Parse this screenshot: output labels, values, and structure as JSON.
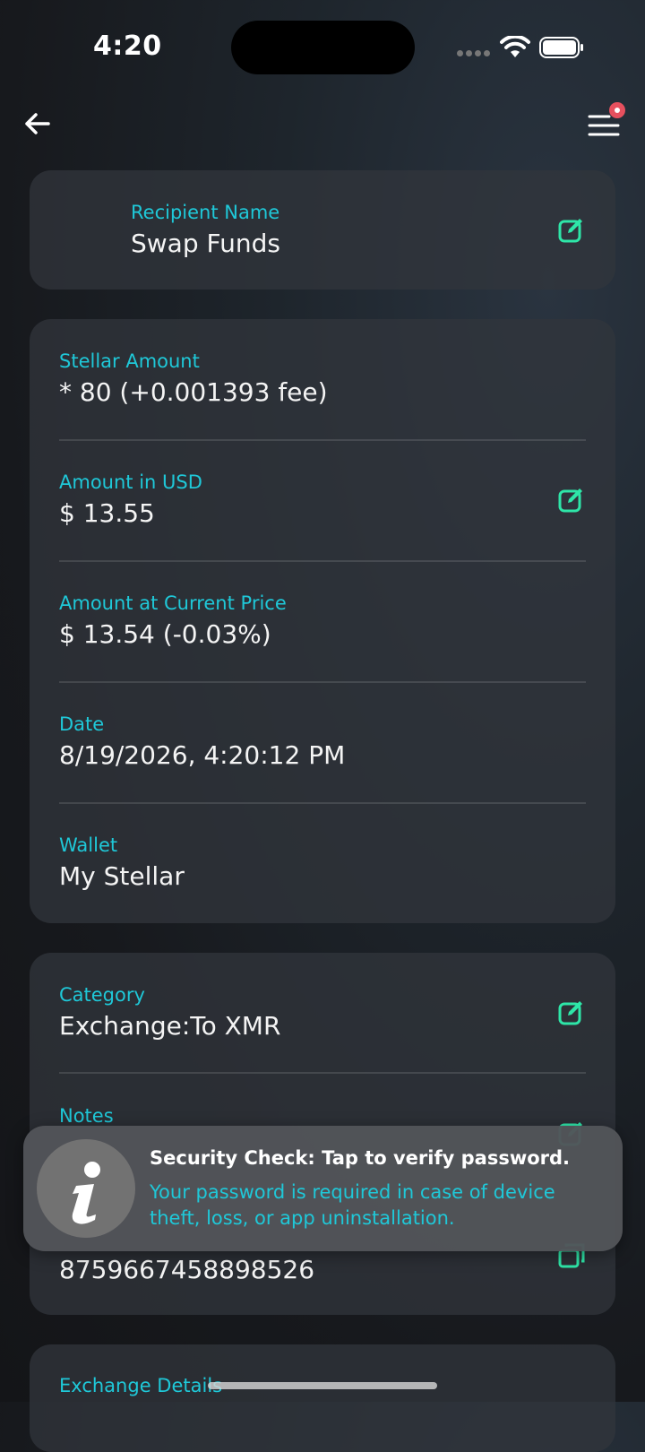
{
  "status_bar": {
    "time": "4:20"
  },
  "recipient": {
    "label": "Recipient Name",
    "value": "Swap Funds"
  },
  "details": {
    "stellar_amount": {
      "label": "Stellar Amount",
      "value": "* 80 (+0.001393 fee)"
    },
    "amount_usd": {
      "label": "Amount in USD",
      "value": "$ 13.55"
    },
    "amount_current": {
      "label": "Amount at Current Price",
      "value": "$ 13.54 (-0.03%)"
    },
    "date": {
      "label": "Date",
      "value": "8/19/2026, 4:20:12 PM"
    },
    "wallet": {
      "label": "Wallet",
      "value": "My Stellar"
    }
  },
  "meta": {
    "category": {
      "label": "Category",
      "value": "Exchange:To XMR"
    },
    "notes": {
      "label": "Notes"
    },
    "id_value": "8759667458898526"
  },
  "exchange": {
    "label": "Exchange Details"
  },
  "toast": {
    "title": "Security Check: Tap to verify password.",
    "body": "Your password is required in case of device theft, loss, or app uninstallation."
  },
  "colors": {
    "accent": "#1fc8d8",
    "icon_green": "#2ee6a8",
    "badge": "#e6505e"
  }
}
